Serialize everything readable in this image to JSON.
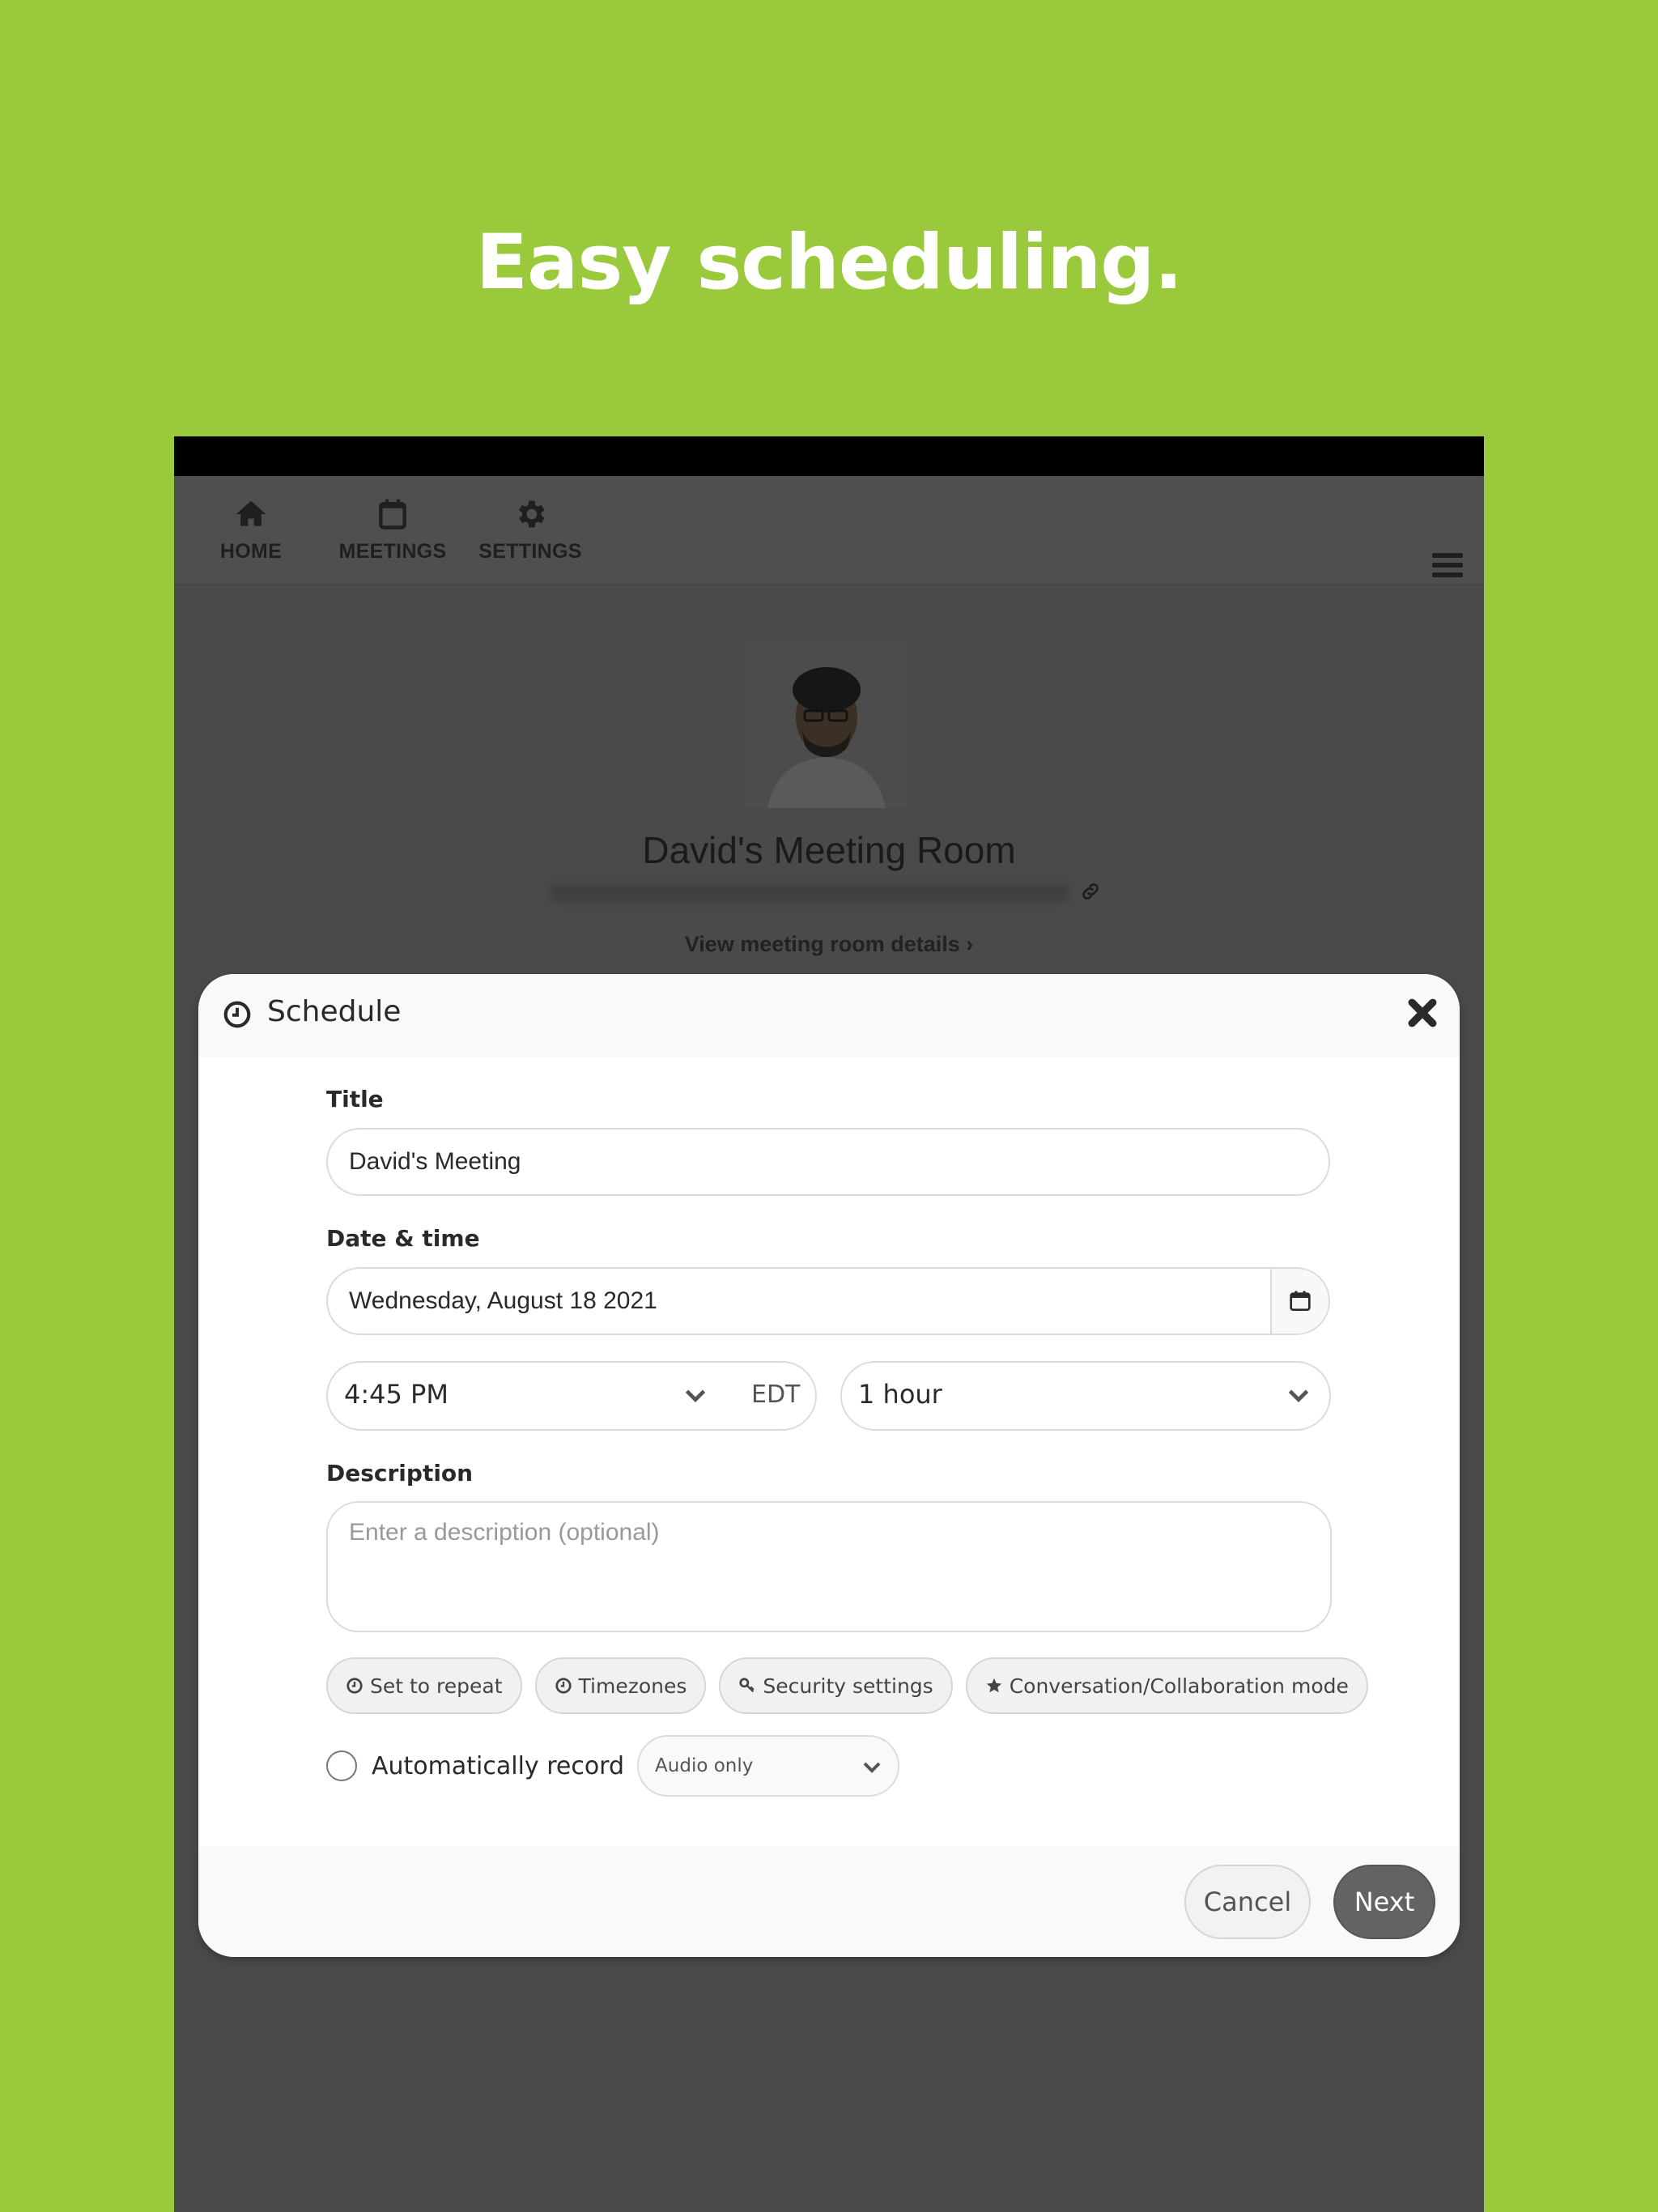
{
  "headline": "Easy scheduling.",
  "colors": {
    "background": "#9aca3c",
    "overlay": "#4a4a4a",
    "next_button": "#636363"
  },
  "nav": {
    "items": [
      {
        "label": "HOME",
        "icon": "home-icon"
      },
      {
        "label": "MEETINGS",
        "icon": "calendar-icon"
      },
      {
        "label": "SETTINGS",
        "icon": "gear-icon"
      }
    ],
    "menu_icon": "hamburger-icon"
  },
  "profile": {
    "room_name": "David's Meeting Room",
    "link_icon": "link-icon",
    "details_link": "View meeting room details ›"
  },
  "modal": {
    "title": "Schedule",
    "title_icon": "clock-icon",
    "close_icon": "close-icon",
    "title_label": "Title",
    "title_value": "David's Meeting",
    "datetime_label": "Date & time",
    "date_value": "Wednesday, August 18 2021",
    "time_value": "4:45 PM",
    "timezone": "EDT",
    "duration_value": "1 hour",
    "description_label": "Description",
    "description_placeholder": "Enter a description (optional)",
    "chips": [
      {
        "label": "Set to repeat",
        "icon": "clock-icon"
      },
      {
        "label": "Timezones",
        "icon": "clock-icon"
      },
      {
        "label": "Security settings",
        "icon": "key-icon"
      },
      {
        "label": "Conversation/Collaboration mode",
        "icon": "star-icon"
      }
    ],
    "auto_record_label": "Automatically record",
    "auto_record_checked": false,
    "record_option": "Audio only",
    "cancel_label": "Cancel",
    "next_label": "Next"
  }
}
